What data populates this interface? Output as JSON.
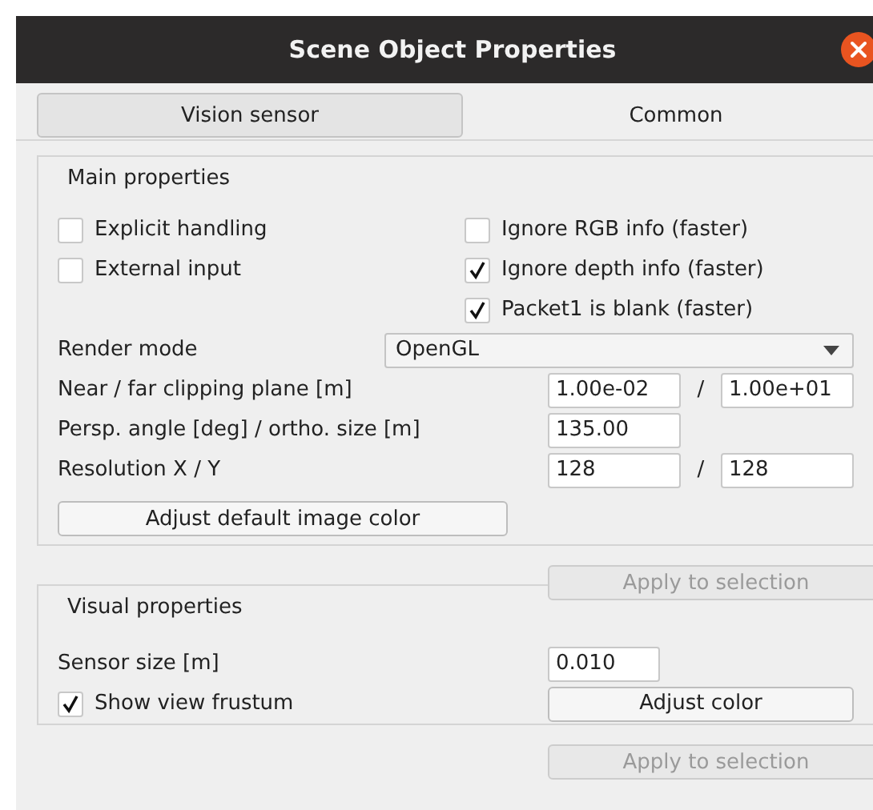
{
  "window": {
    "title": "Scene Object Properties"
  },
  "tabs": [
    {
      "label": "Vision sensor",
      "selected": true
    },
    {
      "label": "Common",
      "selected": false
    }
  ],
  "main_properties": {
    "title": "Main properties",
    "left_checkboxes": [
      {
        "label": "Explicit handling",
        "checked": false
      },
      {
        "label": "External input",
        "checked": false
      }
    ],
    "right_checkboxes": [
      {
        "label": "Ignore RGB info (faster)",
        "checked": false
      },
      {
        "label": "Ignore depth  info (faster)",
        "checked": true
      },
      {
        "label": "Packet1 is blank (faster)",
        "checked": true
      }
    ],
    "render_mode": {
      "label": "Render mode",
      "value": "OpenGL"
    },
    "fields": [
      {
        "label": "Near / far clipping plane [m]",
        "values": [
          "1.00e-02",
          "1.00e+01"
        ],
        "separator": "/"
      },
      {
        "label": "Persp. angle [deg] / ortho. size [m]",
        "values": [
          "135.00"
        ]
      },
      {
        "label": "Resolution X / Y",
        "values": [
          "128",
          "128"
        ],
        "separator": "/"
      }
    ],
    "button": "Adjust default image color"
  },
  "main_apply": {
    "label": "Apply to selection",
    "disabled": true
  },
  "visual_properties": {
    "title": "Visual properties",
    "sensor_size": {
      "label": "Sensor size [m]",
      "value": "0.010"
    },
    "show_view_frustum": {
      "label": "Show view frustum",
      "checked": true
    },
    "button": "Adjust color"
  },
  "visual_apply": {
    "label": "Apply to selection",
    "disabled": true
  }
}
